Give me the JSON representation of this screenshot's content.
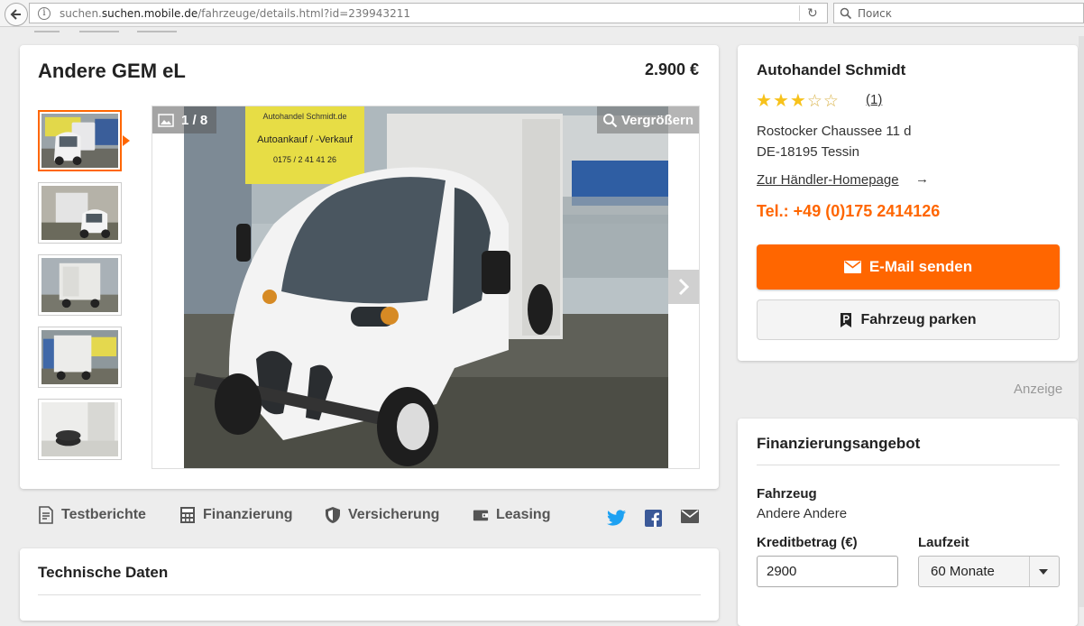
{
  "browser": {
    "url_domain": "suchen.mobile.de",
    "url_path": "/fahrzeuge/details.html?id=239943211",
    "url_prefix": "suchen.",
    "search_placeholder": "Поиск"
  },
  "listing": {
    "title": "Andere GEM eL",
    "price": "2.900 €",
    "photo_counter": "1 / 8",
    "zoom_label": "Vergrößern",
    "thumbnail_count": 5,
    "sign_text": [
      "Autohandel Schmidt.de",
      "Autoankauf / -Verkauf",
      "0175 / 2 41 41 26"
    ]
  },
  "tools": [
    {
      "label": "Testberichte",
      "icon": "document-icon"
    },
    {
      "label": "Finanzierung",
      "icon": "calculator-icon"
    },
    {
      "label": "Versicherung",
      "icon": "shield-icon"
    },
    {
      "label": "Leasing",
      "icon": "wallet-icon"
    }
  ],
  "tech": {
    "title": "Technische Daten"
  },
  "dealer": {
    "name": "Autohandel Schmidt",
    "rating": 3,
    "rating_max": 5,
    "rating_count": "(1)",
    "street": "Rostocker Chaussee 11 d",
    "city": "DE-18195 Tessin",
    "homepage_link": "Zur Händler-Homepage",
    "phone": "Tel.: +49 (0)175 2414126",
    "email_button": "E-Mail senden",
    "park_button": "Fahrzeug parken"
  },
  "ad_label": "Anzeige",
  "financing": {
    "title": "Finanzierungsangebot",
    "vehicle_label": "Fahrzeug",
    "vehicle_value": "Andere Andere",
    "credit_label": "Kreditbetrag (€)",
    "credit_value": "2900",
    "term_label": "Laufzeit",
    "term_value": "60 Monate"
  },
  "colors": {
    "accent": "#ff6600",
    "twitter": "#1da1f2",
    "facebook": "#3b5998"
  }
}
